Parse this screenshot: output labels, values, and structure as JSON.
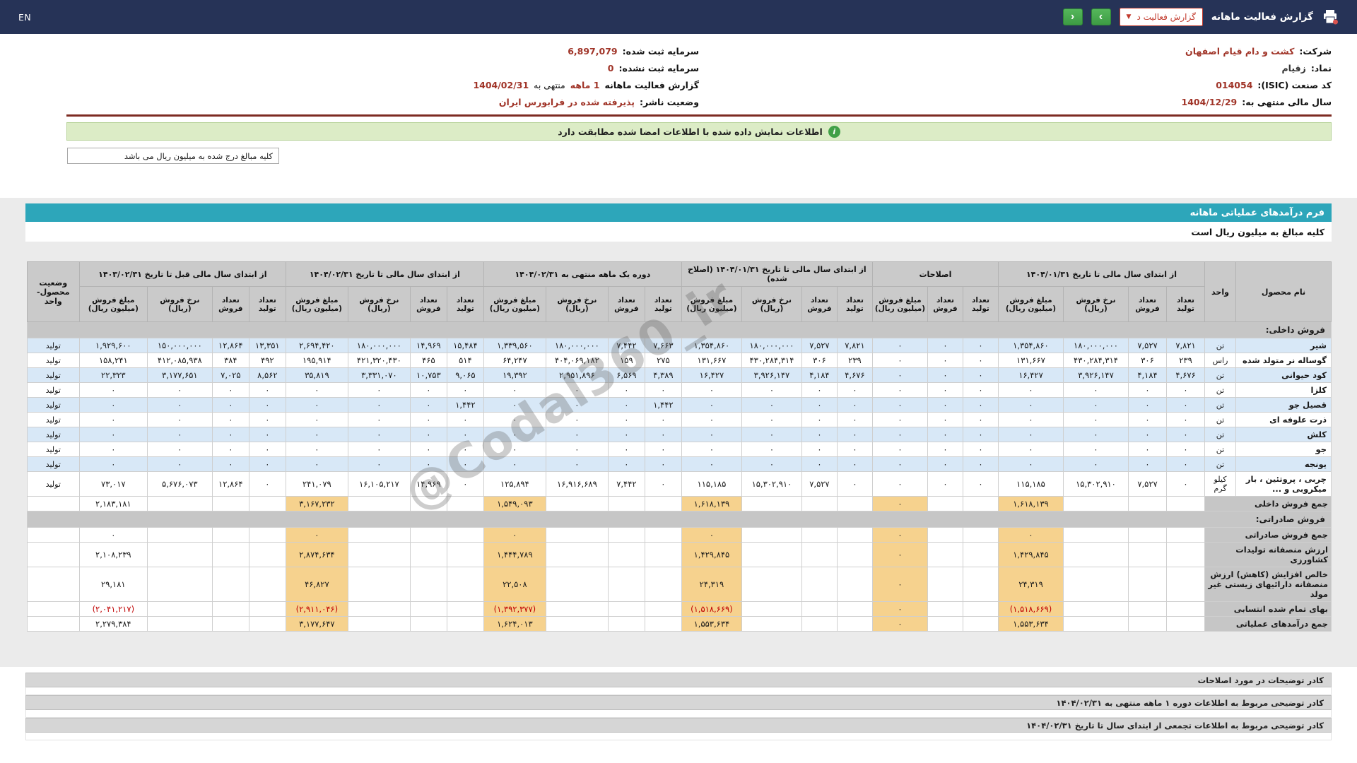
{
  "topbar": {
    "en": "EN",
    "title": "گزارش فعالیت ماهانه",
    "report_select": "گزارش فعالیت د",
    "prev": "‹",
    "next": "›"
  },
  "info": {
    "right": [
      {
        "label": "شرکت:",
        "value": "کشت و دام قیام اصفهان"
      },
      {
        "label": "نماد:",
        "value": "زقیام"
      },
      {
        "label": "کد صنعت (ISIC):",
        "value": "014054"
      },
      {
        "label": "سال مالی منتهی به:",
        "value": "1404/12/29"
      }
    ],
    "left": [
      {
        "label": "سرمایه ثبت شده:",
        "value": "6,897,079"
      },
      {
        "label": "سرمایه ثبت نشده:",
        "value": "0"
      },
      {
        "label": "گزارش فعالیت ماهانه",
        "parts": [
          {
            "t": "1 ماهه"
          },
          {
            "t": "منتهی به"
          },
          {
            "t": "1404/02/31"
          }
        ]
      },
      {
        "label": "وضعیت ناشر:",
        "value": "پذیرفته شده در فرابورس ایران"
      }
    ]
  },
  "banner": {
    "text": "اطلاعات نمایش داده شده با اطلاعات امضا شده مطابقت دارد"
  },
  "unit_note_box": "کلیه مبالغ درج شده به میلیون ریال می باشد",
  "form": {
    "title": "فرم درآمدهای عملیاتی ماهانه",
    "unit_note": "کلیه مبالغ به میلیون ریال است"
  },
  "watermark": "@Codal360_ir",
  "table": {
    "col_product": "نام محصول",
    "col_unit": "واحد",
    "col_status": "وضعیت محصول- واحد",
    "sub": {
      "qp": "تعداد تولید",
      "qs": "تعداد فروش",
      "rate": "نرخ فروش (ریال)",
      "amt": "مبلغ فروش (میلیون ریال)"
    },
    "groups": [
      {
        "label": "از ابتدای سال مالی تا تاریخ ۱۴۰۴/۰۱/۳۱",
        "span": 4
      },
      {
        "label": "اصلاحات",
        "span": 3
      },
      {
        "label": "از ابتدای سال مالی تا تاریخ ۱۴۰۴/۰۱/۳۱ (اصلاح شده)",
        "span": 4
      },
      {
        "label": "دوره یک ماهه منتهی به ۱۴۰۴/۰۲/۳۱",
        "span": 4
      },
      {
        "label": "از ابتدای سال مالی تا تاریخ ۱۴۰۴/۰۲/۳۱",
        "span": 4
      },
      {
        "label": "از ابتدای سال مالی قبل تا تاریخ ۱۴۰۳/۰۲/۳۱",
        "span": 4
      }
    ],
    "rows": [
      {
        "type": "section",
        "name": "فروش داخلی:"
      },
      {
        "type": "product",
        "name": "شیر",
        "unit": "تن",
        "status": "تولید",
        "cells": [
          "۷,۸۲۱",
          "۷,۵۲۷",
          "۱۸۰,۰۰۰,۰۰۰",
          "۱,۳۵۴,۸۶۰",
          "۰",
          "۰",
          "۰",
          "۷,۸۲۱",
          "۷,۵۲۷",
          "۱۸۰,۰۰۰,۰۰۰",
          "۱,۳۵۴,۸۶۰",
          "۷,۶۶۳",
          "۷,۴۴۲",
          "۱۸۰,۰۰۰,۰۰۰",
          "۱,۳۳۹,۵۶۰",
          "۱۵,۴۸۴",
          "۱۴,۹۶۹",
          "۱۸۰,۰۰۰,۰۰۰",
          "۲,۶۹۴,۴۲۰",
          "۱۳,۳۵۱",
          "۱۲,۸۶۴",
          "۱۵۰,۰۰۰,۰۰۰",
          "۱,۹۲۹,۶۰۰"
        ]
      },
      {
        "type": "product",
        "name": "گوساله نر متولد شده",
        "unit": "راس",
        "status": "تولید",
        "cells": [
          "۲۳۹",
          "۳۰۶",
          "۴۳۰,۲۸۴,۳۱۴",
          "۱۳۱,۶۶۷",
          "۰",
          "۰",
          "۰",
          "۲۳۹",
          "۳۰۶",
          "۴۳۰,۲۸۴,۳۱۴",
          "۱۳۱,۶۶۷",
          "۲۷۵",
          "۱۵۹",
          "۴۰۴,۰۶۹,۱۸۲",
          "۶۴,۲۴۷",
          "۵۱۴",
          "۴۶۵",
          "۴۲۱,۳۲۰,۴۳۰",
          "۱۹۵,۹۱۴",
          "۴۹۲",
          "۳۸۴",
          "۴۱۲,۰۸۵,۹۳۸",
          "۱۵۸,۲۴۱"
        ]
      },
      {
        "type": "product",
        "name": "کود حیوانی",
        "unit": "تن",
        "status": "تولید",
        "cells": [
          "۴,۶۷۶",
          "۴,۱۸۴",
          "۳,۹۲۶,۱۴۷",
          "۱۶,۴۲۷",
          "۰",
          "۰",
          "۰",
          "۴,۶۷۶",
          "۴,۱۸۴",
          "۳,۹۲۶,۱۴۷",
          "۱۶,۴۲۷",
          "۴,۳۸۹",
          "۶,۵۶۹",
          "۲,۹۵۱,۸۹۶",
          "۱۹,۳۹۲",
          "۹,۰۶۵",
          "۱۰,۷۵۳",
          "۳,۳۳۱,۰۷۰",
          "۳۵,۸۱۹",
          "۸,۵۶۲",
          "۷,۰۲۵",
          "۳,۱۷۷,۶۵۱",
          "۲۲,۳۲۳"
        ]
      },
      {
        "type": "product",
        "name": "کلزا",
        "unit": "تن",
        "status": "تولید",
        "cells": [
          "۰",
          "۰",
          "۰",
          "۰",
          "۰",
          "۰",
          "۰",
          "۰",
          "۰",
          "۰",
          "۰",
          "۰",
          "۰",
          "۰",
          "۰",
          "۰",
          "۰",
          "۰",
          "۰",
          "۰",
          "۰",
          "۰",
          "۰"
        ]
      },
      {
        "type": "product",
        "name": "قصیل جو",
        "unit": "تن",
        "status": "تولید",
        "cells": [
          "۰",
          "۰",
          "۰",
          "۰",
          "۰",
          "۰",
          "۰",
          "۰",
          "۰",
          "۰",
          "۰",
          "۱,۴۴۲",
          "۰",
          "۰",
          "۰",
          "۱,۴۴۲",
          "۰",
          "۰",
          "۰",
          "۰",
          "۰",
          "۰",
          "۰"
        ]
      },
      {
        "type": "product",
        "name": "ذرت علوفه ای",
        "unit": "تن",
        "status": "تولید",
        "cells": [
          "۰",
          "۰",
          "۰",
          "۰",
          "۰",
          "۰",
          "۰",
          "۰",
          "۰",
          "۰",
          "۰",
          "۰",
          "۰",
          "۰",
          "۰",
          "۰",
          "۰",
          "۰",
          "۰",
          "۰",
          "۰",
          "۰",
          "۰"
        ]
      },
      {
        "type": "product",
        "name": "کلش",
        "unit": "تن",
        "status": "تولید",
        "cells": [
          "۰",
          "۰",
          "۰",
          "۰",
          "۰",
          "۰",
          "۰",
          "۰",
          "۰",
          "۰",
          "۰",
          "۰",
          "۰",
          "۰",
          "۰",
          "۰",
          "۰",
          "۰",
          "۰",
          "۰",
          "۰",
          "۰",
          "۰"
        ]
      },
      {
        "type": "product",
        "name": "جو",
        "unit": "تن",
        "status": "تولید",
        "cells": [
          "۰",
          "۰",
          "۰",
          "۰",
          "۰",
          "۰",
          "۰",
          "۰",
          "۰",
          "۰",
          "۰",
          "۰",
          "۰",
          "۰",
          "۰",
          "۰",
          "۰",
          "۰",
          "۰",
          "۰",
          "۰",
          "۰",
          "۰"
        ]
      },
      {
        "type": "product",
        "name": "یونجه",
        "unit": "تن",
        "status": "تولید",
        "cells": [
          "۰",
          "۰",
          "۰",
          "۰",
          "۰",
          "۰",
          "۰",
          "۰",
          "۰",
          "۰",
          "۰",
          "۰",
          "۰",
          "۰",
          "۰",
          "۰",
          "۰",
          "۰",
          "۰",
          "۰",
          "۰",
          "۰",
          "۰"
        ]
      },
      {
        "type": "product",
        "name": "چربی ، پروتئین ، بار میکروبی و ...",
        "unit": "کیلو گرم",
        "status": "تولید",
        "cells": [
          "۰",
          "۷,۵۲۷",
          "۱۵,۳۰۲,۹۱۰",
          "۱۱۵,۱۸۵",
          "۰",
          "۰",
          "۰",
          "۰",
          "۷,۵۲۷",
          "۱۵,۳۰۲,۹۱۰",
          "۱۱۵,۱۸۵",
          "۰",
          "۷,۴۴۲",
          "۱۶,۹۱۶,۶۸۹",
          "۱۲۵,۸۹۴",
          "۰",
          "۱۴,۹۶۹",
          "۱۶,۱۰۵,۲۱۷",
          "۲۴۱,۰۷۹",
          "۰",
          "۱۲,۸۶۴",
          "۵,۶۷۶,۰۷۳",
          "۷۳,۰۱۷"
        ]
      },
      {
        "type": "total",
        "name": "جمع فروش داخلی",
        "amounts": [
          "۱,۶۱۸,۱۳۹",
          "۰",
          "۱,۶۱۸,۱۳۹",
          "۱,۵۴۹,۰۹۳",
          "۳,۱۶۷,۲۳۲",
          "۲,۱۸۳,۱۸۱"
        ]
      },
      {
        "type": "section",
        "name": "فروش صادراتی:"
      },
      {
        "type": "total",
        "name": "جمع فروش صادراتی",
        "amounts": [
          "۰",
          "۰",
          "۰",
          "۰",
          "۰",
          "۰"
        ]
      },
      {
        "type": "total",
        "name": "ارزش منصفانه تولیدات کشاورزی",
        "amounts": [
          "۱,۴۲۹,۸۴۵",
          "۰",
          "۱,۴۲۹,۸۴۵",
          "۱,۴۴۴,۷۸۹",
          "۲,۸۷۴,۶۳۴",
          "۲,۱۰۸,۲۳۹"
        ]
      },
      {
        "type": "total",
        "name": "خالص افزایش (کاهش) ارزش منصفانه دارائیهای زیستی غیر مولد",
        "amounts": [
          "۲۴,۳۱۹",
          "۰",
          "۲۴,۳۱۹",
          "۲۲,۵۰۸",
          "۴۶,۸۲۷",
          "۲۹,۱۸۱"
        ]
      },
      {
        "type": "total",
        "name": "بهای تمام شده انتسابی",
        "amounts": [
          "(۱,۵۱۸,۶۶۹)",
          "۰",
          "(۱,۵۱۸,۶۶۹)",
          "(۱,۳۹۲,۳۷۷)",
          "(۲,۹۱۱,۰۴۶)",
          "(۲,۰۴۱,۲۱۷)"
        ]
      },
      {
        "type": "total",
        "name": "جمع درآمدهای عملیاتی",
        "amounts": [
          "۱,۵۵۳,۶۳۴",
          "۰",
          "۱,۵۵۳,۶۳۴",
          "۱,۶۲۴,۰۱۳",
          "۳,۱۷۷,۶۴۷",
          "۲,۲۷۹,۳۸۴"
        ]
      }
    ]
  },
  "notes": [
    "کادر توضیحات در مورد اصلاحات",
    "کادر توضیحی مربوط به اطلاعات دوره ۱ ماهه منتهی به ۱۴۰۴/۰۲/۳۱",
    "کادر توضیحی مربوط به اطلاعات تجمعی از ابتدای سال تا تاریخ ۱۴۰۴/۰۲/۳۱"
  ]
}
